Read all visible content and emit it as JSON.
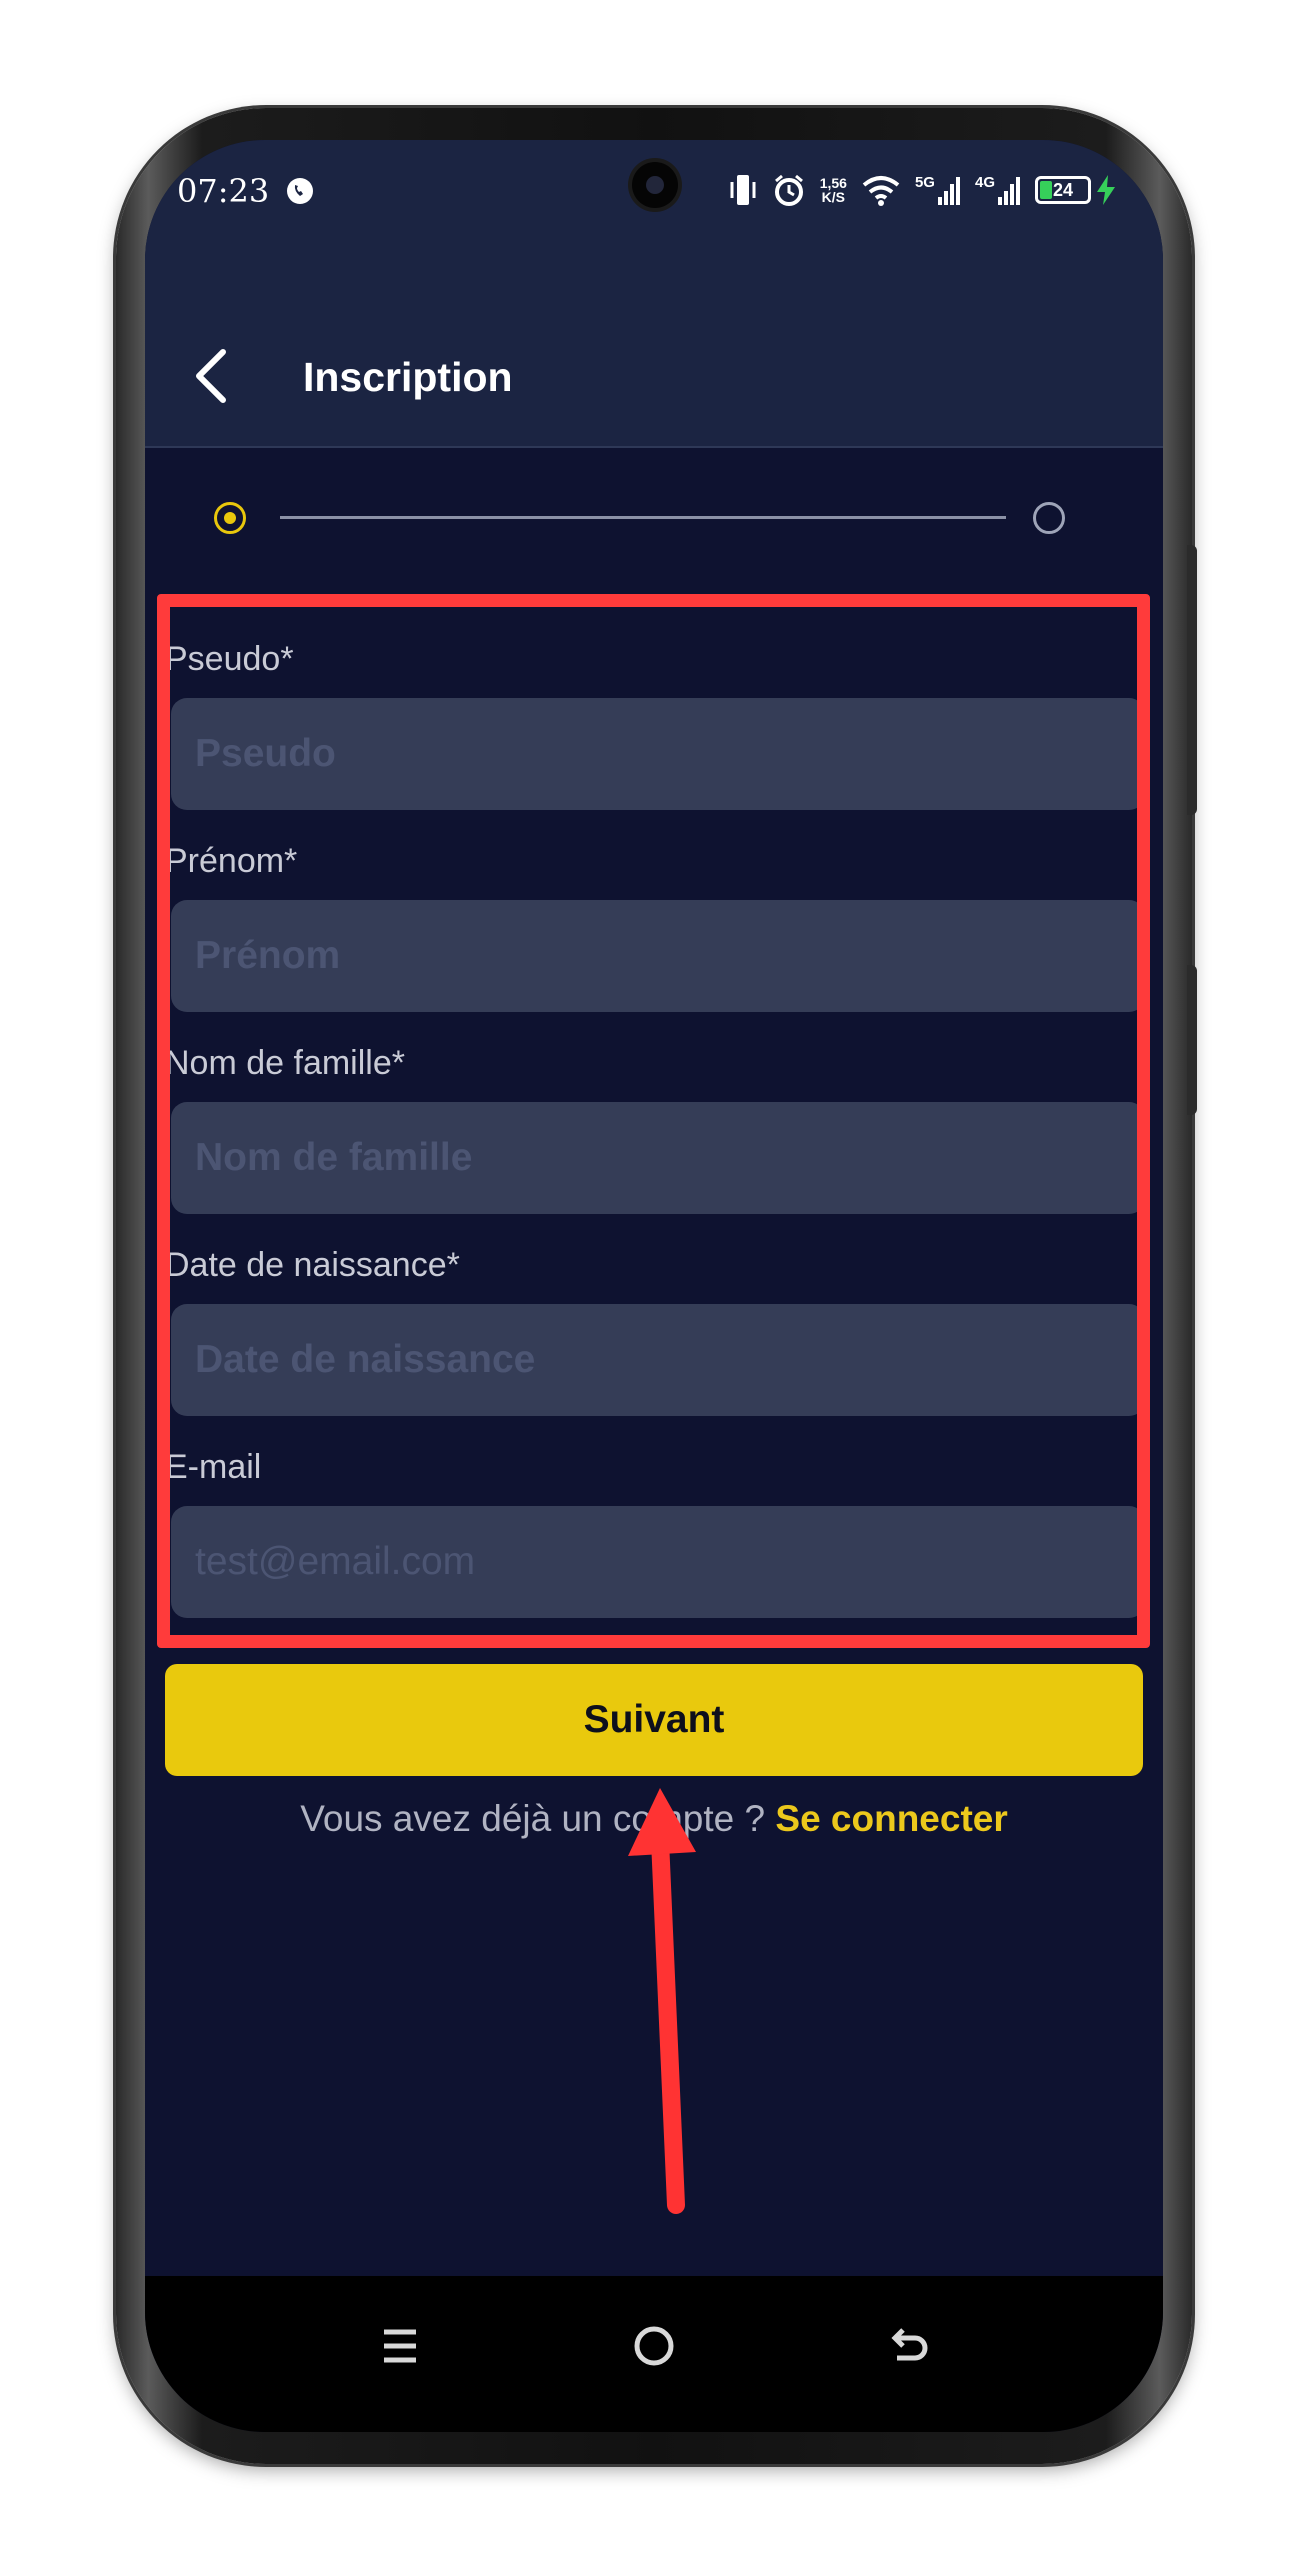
{
  "status_bar": {
    "time": "07:23",
    "net_speed_value": "1,56",
    "net_speed_unit": "K/S",
    "network_5g": "5G",
    "network_4g": "4G",
    "battery_level": "24"
  },
  "app_bar": {
    "title": "Inscription"
  },
  "stepper": {
    "current_step": 1,
    "total_steps": 2
  },
  "form": {
    "fields": [
      {
        "label": "Pseudo*",
        "placeholder": "Pseudo",
        "value": ""
      },
      {
        "label": "Prénom*",
        "placeholder": "Prénom",
        "value": ""
      },
      {
        "label": "Nom de famille*",
        "placeholder": "Nom de famille",
        "value": ""
      },
      {
        "label": "Date de naissance*",
        "placeholder": "Date de naissance",
        "value": ""
      },
      {
        "label": "E-mail",
        "placeholder": "test@email.com",
        "value": ""
      }
    ]
  },
  "actions": {
    "next_label": "Suivant",
    "login_prompt": "Vous avez déjà un compte ?",
    "login_link": "Se connecter"
  },
  "colors": {
    "background": "#0e1230",
    "app_bar": "#1b2442",
    "input": "#353d57",
    "accent": "#e9c90d",
    "annotation": "#ff3b3b"
  },
  "icons": {
    "back": "chevron-left-icon",
    "menu": "menu-icon",
    "home": "home-circle-icon",
    "return": "back-arrow-icon"
  }
}
